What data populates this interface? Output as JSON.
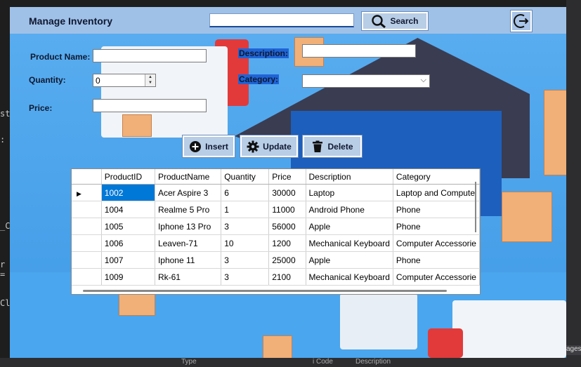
{
  "window": {
    "title": "Manage Inventory"
  },
  "search": {
    "value": "",
    "button_label": "Search"
  },
  "form": {
    "product_name_label": "Product Name:",
    "description_label": "Description:",
    "quantity_label": "Quantity:",
    "category_label": "Category:",
    "price_label": "Price:",
    "product_name_value": "",
    "description_value": "",
    "quantity_value": "0",
    "category_value": "",
    "price_value": ""
  },
  "actions": {
    "insert": "Insert",
    "update": "Update",
    "delete": "Delete"
  },
  "grid": {
    "columns": [
      "ProductID",
      "ProductName",
      "Quantity",
      "Price",
      "Description",
      "Category"
    ],
    "rows": [
      [
        "1002",
        "Acer Aspire 3",
        "6",
        "30000",
        "Laptop",
        "Laptop and Compute"
      ],
      [
        "1004",
        "Realme 5 Pro",
        "1",
        "11000",
        "Android Phone",
        "Phone"
      ],
      [
        "1005",
        "Iphone 13 Pro",
        "3",
        "56000",
        "Apple",
        "Phone"
      ],
      [
        "1006",
        "Leaven-71",
        "10",
        "1200",
        "Mechanical Keyboard",
        "Computer Accessorie"
      ],
      [
        "1007",
        "Iphone 11",
        "3",
        "25000",
        "Apple",
        "Phone"
      ],
      [
        "1009",
        "Rk-61",
        "3",
        "2100",
        "Mechanical Keyboard",
        "Computer Accessorie"
      ]
    ]
  },
  "ide": {
    "left_glyphs": [
      "ste",
      ":",
      "_C",
      "r =",
      "Cl"
    ],
    "bottom_texts": [
      "Type",
      "i Code",
      "Description"
    ],
    "right_tab": "ages"
  },
  "colors": {
    "accent": "#0078d7",
    "topbar": "#9fc1e8",
    "button": "#b8cde6"
  }
}
